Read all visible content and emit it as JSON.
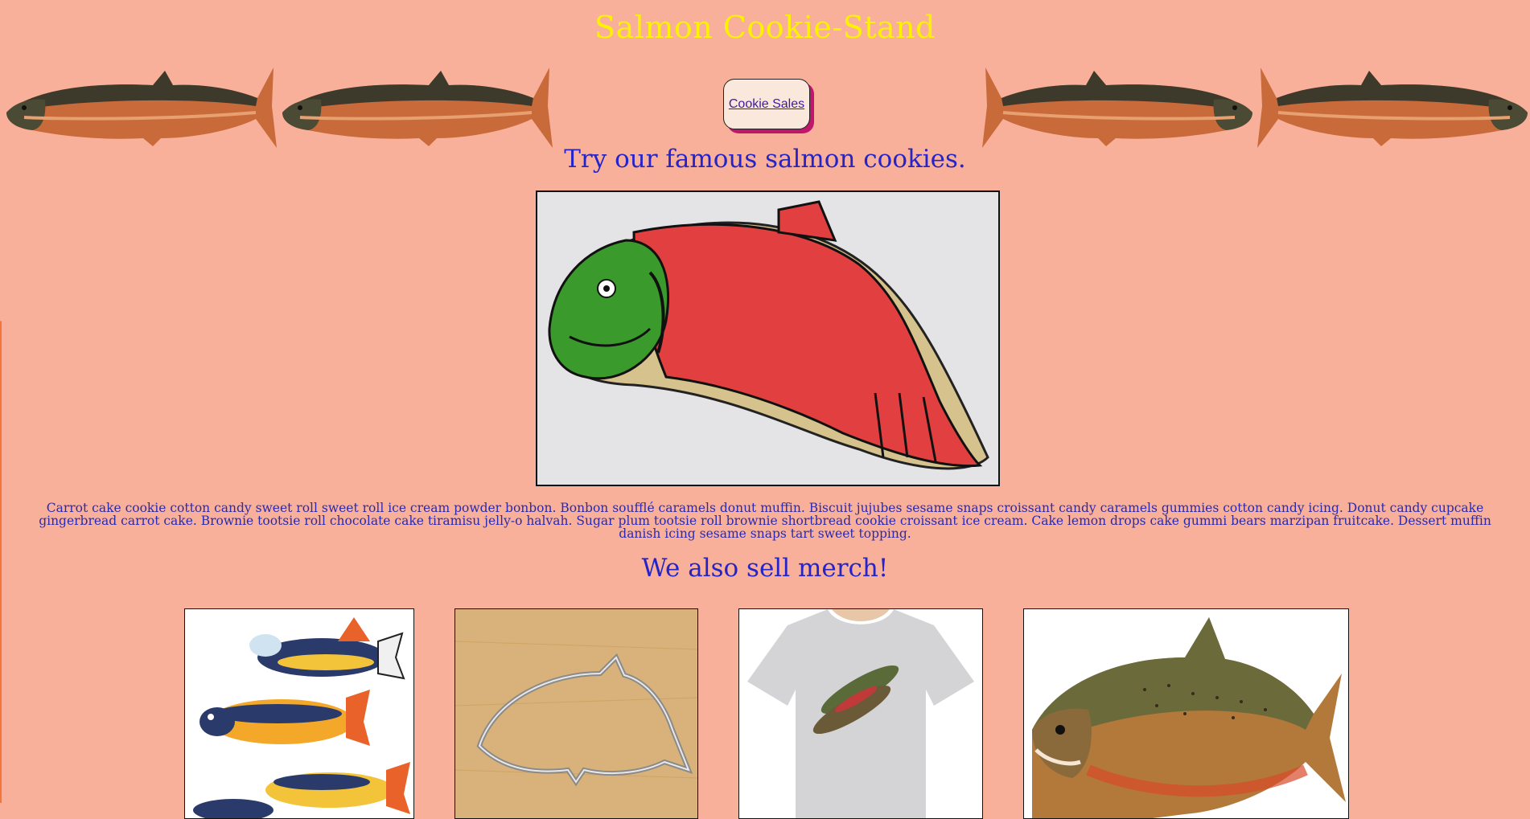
{
  "header": {
    "title": "Salmon Cookie-Stand"
  },
  "nav": {
    "cookie_sales_label": "Cookie Sales"
  },
  "main": {
    "headline": "Try our famous salmon cookies.",
    "description": "Carrot cake cookie cotton candy sweet roll sweet roll ice cream powder bonbon. Bonbon soufflé caramels donut muffin. Biscuit jujubes sesame snaps croissant candy caramels gummies cotton candy icing. Donut candy cupcake gingerbread carrot cake. Brownie tootsie roll chocolate cake tiramisu jelly-o halvah. Sugar plum tootsie roll brownie shortbread cookie croissant ice cream. Cake lemon drops cake gummi bears marzipan fruitcake. Dessert muffin danish icing sesame snaps tart sweet topping.",
    "merch_heading": "We also sell merch!"
  },
  "colors": {
    "background": "#f8b09a",
    "title": "#fff200",
    "heading": "#2424c8",
    "button_shadow": "#c0166b"
  }
}
